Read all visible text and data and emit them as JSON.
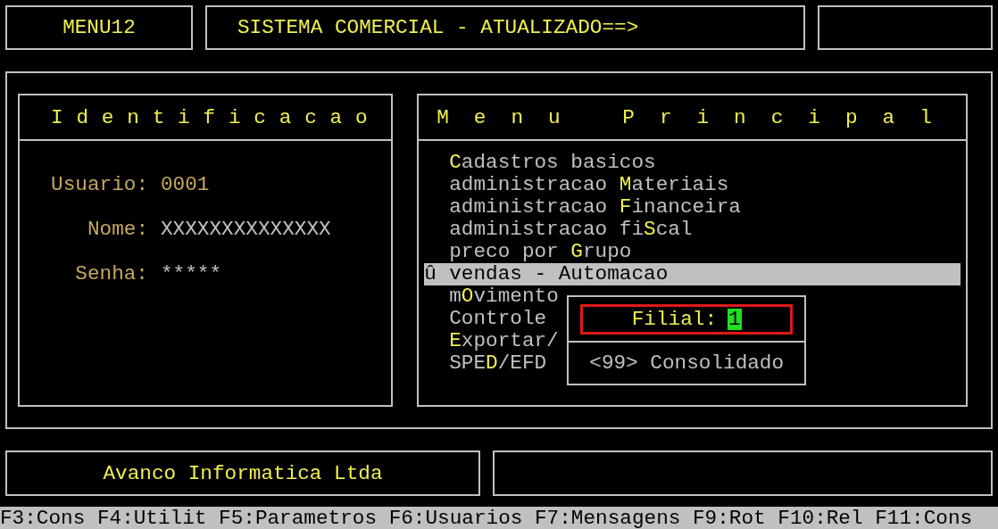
{
  "header": {
    "program": "MENU12",
    "title": "SISTEMA COMERCIAL - ATUALIZADO==>"
  },
  "identification": {
    "title": "Identificacao",
    "fields": [
      {
        "label": "Usuario:",
        "value": "0001"
      },
      {
        "label": "Nome:",
        "value": "XXXXXXXXXXXXXX"
      },
      {
        "label": "Senha:",
        "value": "*****"
      }
    ]
  },
  "main_menu": {
    "title": "Menu Principal",
    "cursor": "û",
    "items": [
      {
        "label": "**C**adastros basicos",
        "selected": false
      },
      {
        "label": "administracao **M**ateriais",
        "selected": false
      },
      {
        "label": "administracao **F**inanceira",
        "selected": false
      },
      {
        "label": "administracao fi**S**cal",
        "selected": false
      },
      {
        "label": "preco por **G**rupo",
        "selected": false
      },
      {
        "label": "vendas - Automacao",
        "selected": true
      },
      {
        "label": "m**O**vimento",
        "selected": false
      },
      {
        "label": "Controle",
        "selected": false
      },
      {
        "label": "**E**xportar/",
        "selected": false
      },
      {
        "label": "SPE**D**/EFD",
        "selected": false
      }
    ]
  },
  "branch_dialog": {
    "label": "Filial:",
    "value": "1",
    "option": "<99> Consolidado"
  },
  "company": "Avanco Informatica Ltda",
  "function_keys": [
    "F3:Cons",
    "F4:Utilit",
    "F5:Parametros",
    "F6:Usuarios",
    "F7:Mensagens",
    "F9:Rot",
    "F10:Rel",
    "F11:Cons"
  ]
}
